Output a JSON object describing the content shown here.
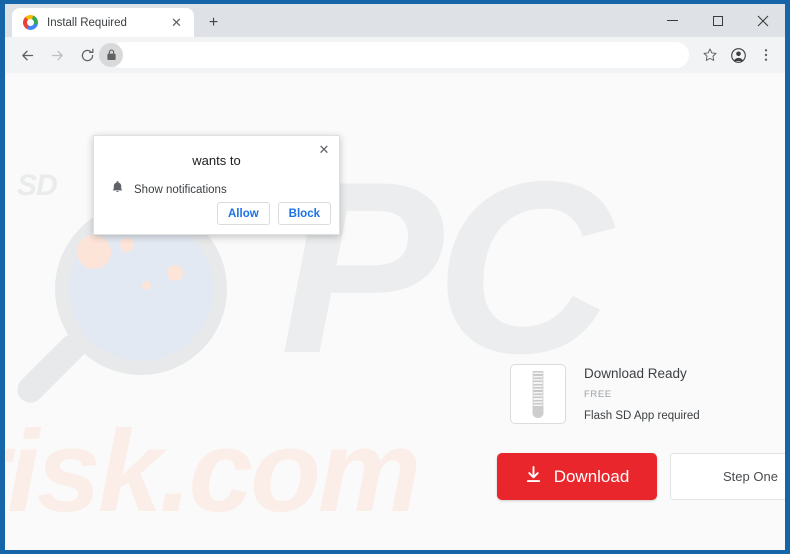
{
  "window": {
    "controls": {
      "minimize": "minimize-button",
      "maximize": "maximize-button",
      "close": "close-button"
    }
  },
  "tabstrip": {
    "tab": {
      "title": "Install Required",
      "favicon": "chrome-favicon",
      "close_label": "✕"
    },
    "new_tab_label": "+"
  },
  "toolbar": {
    "back": "back-arrow-icon",
    "forward": "forward-arrow-icon",
    "reload": "reload-icon",
    "lock": "lock-icon",
    "url_value": "",
    "url_placeholder": "",
    "bookmark": "star-icon",
    "profile": "profile-avatar-icon",
    "menu": "three-dot-menu-icon"
  },
  "permission_dialog": {
    "title": "wants to",
    "permission_label": "Show notifications",
    "permission_icon": "bell-icon",
    "close_label": "✕",
    "allow_label": "Allow",
    "block_label": "Block",
    "link_color": "#1a73e8"
  },
  "page": {
    "watermarks": {
      "logo_text": "SD",
      "big_letters": "PC",
      "domain_text": "risk.com"
    },
    "download_card": {
      "icon": "zip-file-icon",
      "title": "Download Ready",
      "price": "FREE",
      "requirement": "Flash SD App required"
    },
    "download_button": {
      "label": "Download",
      "icon": "download-arrow-icon",
      "color": "#e8262b"
    },
    "step_panel": {
      "label": "Step One"
    }
  }
}
